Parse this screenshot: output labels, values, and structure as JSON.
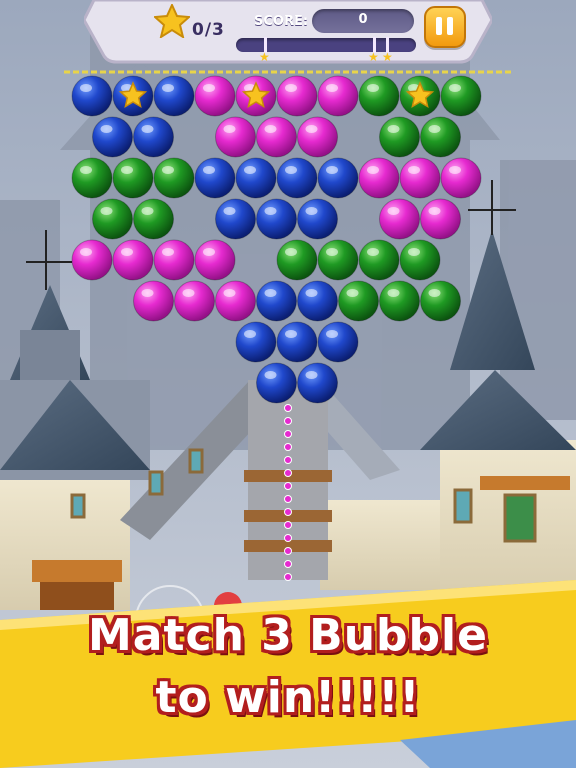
{
  "hud": {
    "stars_collected": "0/3",
    "score_label": "SCORE:",
    "score_value": "0",
    "score_progress": 0,
    "pause_icon": "pause-icon"
  },
  "board": {
    "rows": [
      [
        "blue",
        "blue-star",
        "blue",
        "magenta",
        "magenta-star",
        "magenta",
        "magenta",
        "green",
        "green-star",
        "green"
      ],
      [
        "blue",
        "blue",
        "",
        "magenta",
        "magenta",
        "magenta",
        "",
        "green",
        "green"
      ],
      [
        "green",
        "green",
        "green",
        "blue",
        "blue",
        "blue",
        "blue",
        "magenta",
        "magenta",
        "magenta"
      ],
      [
        "green",
        "green",
        "",
        "blue",
        "blue",
        "blue",
        "",
        "magenta",
        "magenta"
      ],
      [
        "magenta",
        "magenta",
        "magenta",
        "magenta",
        "",
        "green",
        "green",
        "green",
        "green"
      ],
      [
        "",
        "magenta",
        "magenta",
        "magenta",
        "blue",
        "blue",
        "green",
        "green",
        "green"
      ],
      [
        "",
        "",
        "",
        "",
        "blue",
        "blue",
        "blue"
      ],
      [
        "",
        "",
        "",
        "",
        "blue",
        "blue"
      ]
    ],
    "colors": {
      "blue": "#1e3fc4",
      "magenta": "#e62ad0",
      "green": "#1f9a23"
    }
  },
  "banner": {
    "line1": "Match 3 Bubble",
    "line2": "to win!!!!!",
    "bg_color": "#f7cc1e"
  }
}
